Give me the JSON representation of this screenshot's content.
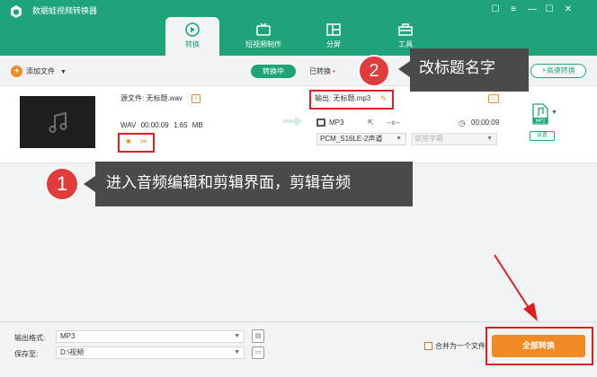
{
  "app": {
    "title": "数据蛙视频转换器",
    "window_controls": [
      "☐",
      "≡",
      "—",
      "☐",
      "✕"
    ]
  },
  "nav": {
    "tabs": [
      {
        "label": "转换",
        "icon": "convert-icon",
        "active": true
      },
      {
        "label": "短视频制作",
        "icon": "tv-icon",
        "active": false
      },
      {
        "label": "分屏",
        "icon": "split-screen-icon",
        "active": false
      },
      {
        "label": "工具",
        "icon": "toolbox-icon",
        "active": false
      }
    ]
  },
  "toolbar": {
    "add_file": "添加文件",
    "converting": "转换中",
    "converted": "已转换",
    "converted_dot": "•",
    "high_speed": "高速转换"
  },
  "file": {
    "source_label": "源文件: 无标题.wav",
    "format": "WAV",
    "duration": "00:00:09",
    "size": "1.65 MB",
    "output_label": "输出: 无标题.mp3",
    "output_format": "MP3",
    "output_resolution": "--x--",
    "output_duration": "00:00:09",
    "audio_track": "PCM_S16LE-2声道",
    "subtitle": "禁用字幕",
    "settings": "设置",
    "format_badge": "MP3"
  },
  "callouts": {
    "one": {
      "number": "1",
      "text": "进入音频编辑和剪辑界面，剪辑音频"
    },
    "two": {
      "number": "2",
      "text": "改标题名字"
    }
  },
  "bottom": {
    "output_format_label": "输出格式:",
    "output_format_value": "MP3",
    "save_to_label": "保存至:",
    "save_to_value": "D:\\视频",
    "merge_label": "合并为一个文件",
    "convert_all": "全部转换"
  },
  "colors": {
    "brand_green": "#1fa37a",
    "accent_orange": "#f08a24",
    "highlight_red": "#e02020",
    "callout_gray": "#4a4a4a"
  }
}
